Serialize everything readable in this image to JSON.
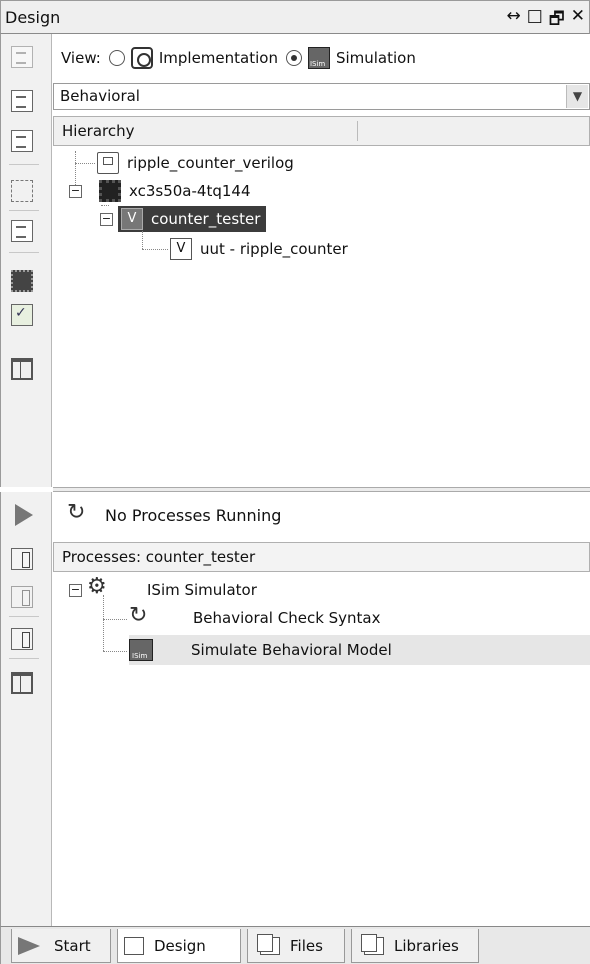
{
  "panel": {
    "title": "Design",
    "controls": [
      "↔",
      "□",
      "🗗",
      "✕"
    ]
  },
  "view": {
    "label": "View:",
    "options": [
      {
        "label": "Implementation",
        "selected": false
      },
      {
        "label": "Simulation",
        "selected": true
      }
    ]
  },
  "mode_select": {
    "value": "Behavioral"
  },
  "hierarchy": {
    "header": "Hierarchy",
    "nodes": [
      {
        "label": "ripple_counter_verilog",
        "icon": "project-icon"
      },
      {
        "label": "xc3s50a-4tq144",
        "icon": "device-chip-icon"
      },
      {
        "label": "counter_tester",
        "icon": "verilog-module-icon",
        "selected": true
      },
      {
        "label": "uut - ripple_counter",
        "icon": "verilog-module-icon"
      }
    ]
  },
  "status": {
    "text": "No Processes Running"
  },
  "processes": {
    "header": "Processes: counter_tester",
    "nodes": [
      {
        "label": "ISim Simulator",
        "icon": "gear-tools-icon"
      },
      {
        "label": "Behavioral Check Syntax",
        "icon": "cycle-arrows-icon"
      },
      {
        "label": "Simulate Behavioral Model",
        "icon": "isim-icon",
        "highlighted": true
      }
    ]
  },
  "tabs": [
    {
      "label": "Start",
      "icon": "start-icon"
    },
    {
      "label": "Design",
      "icon": "design-icon",
      "active": true
    },
    {
      "label": "Files",
      "icon": "files-icon"
    },
    {
      "label": "Libraries",
      "icon": "libraries-icon"
    }
  ]
}
